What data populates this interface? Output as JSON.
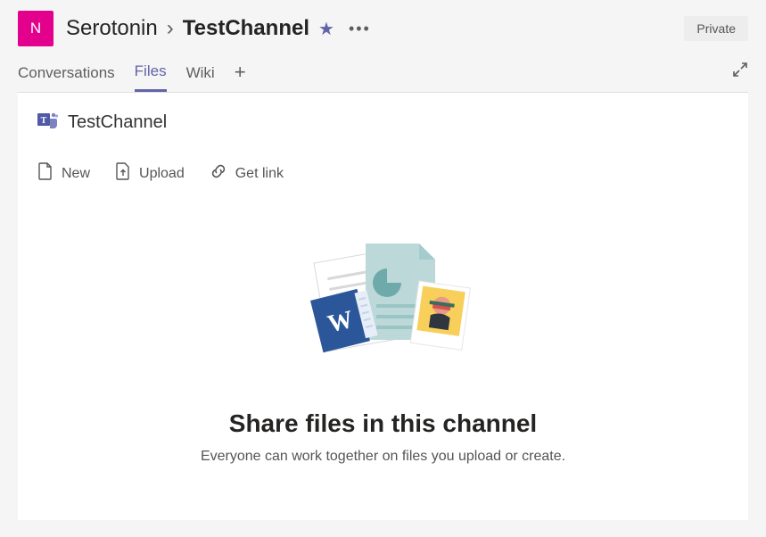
{
  "header": {
    "avatar_letter": "N",
    "team_name": "Serotonin",
    "channel_name": "TestChannel",
    "privacy_label": "Private"
  },
  "tabs": {
    "conversations": "Conversations",
    "files": "Files",
    "wiki": "Wiki"
  },
  "folder": {
    "title": "TestChannel"
  },
  "actions": {
    "new": "New",
    "upload": "Upload",
    "get_link": "Get link"
  },
  "empty_state": {
    "title": "Share files in this channel",
    "subtitle": "Everyone can work together on files you upload or create."
  }
}
